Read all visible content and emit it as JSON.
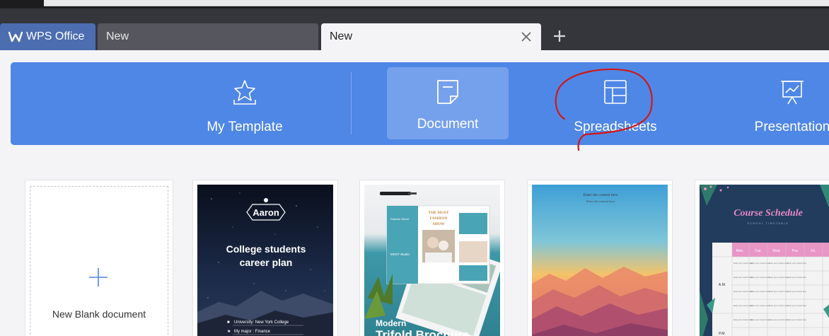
{
  "tabs": [
    {
      "label": "WPS Office",
      "active": false
    },
    {
      "label": "New",
      "active": false
    },
    {
      "label": "New",
      "active": true
    }
  ],
  "categories": {
    "my_template": "My Template",
    "document": "Document",
    "spreadsheets": "Spreadsheets",
    "presentation": "Presentation"
  },
  "selected_category": "Document",
  "blank_card": {
    "label": "New Blank document"
  },
  "templates": [
    {
      "name_badge": "Aaron",
      "title_line1": "College students",
      "title_line2": "career plan",
      "info_line1": "University: New York College",
      "info_line2": "My major : Finance"
    },
    {
      "brochure_heading_line1": "THE MOST",
      "brochure_heading_line2": "FASHION",
      "brochure_heading_line3": "SHOW",
      "brochure_side_text": "Fashion World",
      "brochure_studio": "MOST Studio",
      "caption_line1": "Modern",
      "caption_line2": "Trifold Brochure"
    },
    {
      "header_line1": "Enter the content here",
      "header_line2": "Enter the content here"
    },
    {
      "title": "Course Schedule",
      "subtitle": "SCHOOL TIMETABLE",
      "days": [
        "Mon.",
        "Tue.",
        "Wed.",
        "Thu.",
        "Fri."
      ],
      "period_am": "A.M.",
      "period_pm": "P.M.",
      "cell_text": "Enter your content here"
    }
  ],
  "colors": {
    "tabbar": "#35363c",
    "wps_tab": "#4c6db0",
    "category_bar": "#4f87e6",
    "category_selected": "#75a0ec",
    "annotation": "#d01818"
  }
}
